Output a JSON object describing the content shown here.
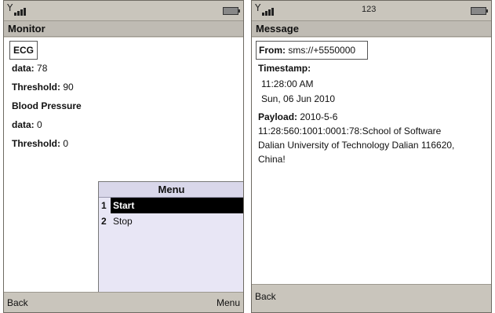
{
  "left_screen": {
    "status": {
      "signal_label": "Y",
      "battery_icon": "battery-icon"
    },
    "title": "Monitor",
    "ecg": {
      "heading": "ECG",
      "data_label": "data:",
      "data_value": "78",
      "threshold_label": "Threshold:",
      "threshold_value": "90"
    },
    "bp": {
      "heading": "Blood Pressure",
      "data_label": "data:",
      "data_value": "0",
      "threshold_label": "Threshold:",
      "threshold_value": "0"
    },
    "menu": {
      "title": "Menu",
      "items": [
        {
          "num": "1",
          "label": "Start"
        },
        {
          "num": "2",
          "label": "Stop"
        }
      ]
    },
    "softkeys": {
      "left": "Back",
      "right": "Menu"
    }
  },
  "right_screen": {
    "status": {
      "signal_label": "Y",
      "count": "123",
      "battery_icon": "battery-icon"
    },
    "title": "Message",
    "from_label": "From:",
    "from_value": "sms://+5550000",
    "timestamp_label": "Timestamp:",
    "time": "11:28:00 AM",
    "date": "Sun, 06 Jun 2010",
    "payload_label": "Payload:",
    "payload_line1": "2010-5-6",
    "payload_line2": "11:28:560:1001:0001:78:School of Software",
    "payload_line3": "Dalian University of Technology Dalian 116620,",
    "payload_line4": "China!",
    "softkeys": {
      "left": "Back"
    }
  }
}
